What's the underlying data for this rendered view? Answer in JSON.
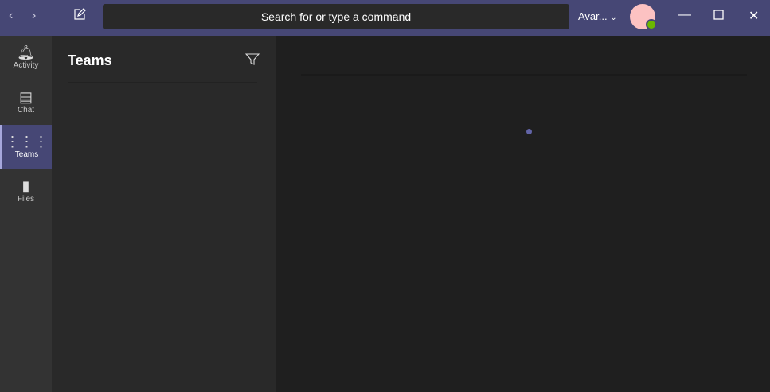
{
  "titlebar": {
    "search_placeholder": "Search for or type a command",
    "org": "Avar..."
  },
  "rail": {
    "items": [
      {
        "label": "Activity"
      },
      {
        "label": "Chat"
      },
      {
        "label": "Teams"
      },
      {
        "label": "Files"
      }
    ]
  },
  "panel": {
    "title": "Teams"
  }
}
